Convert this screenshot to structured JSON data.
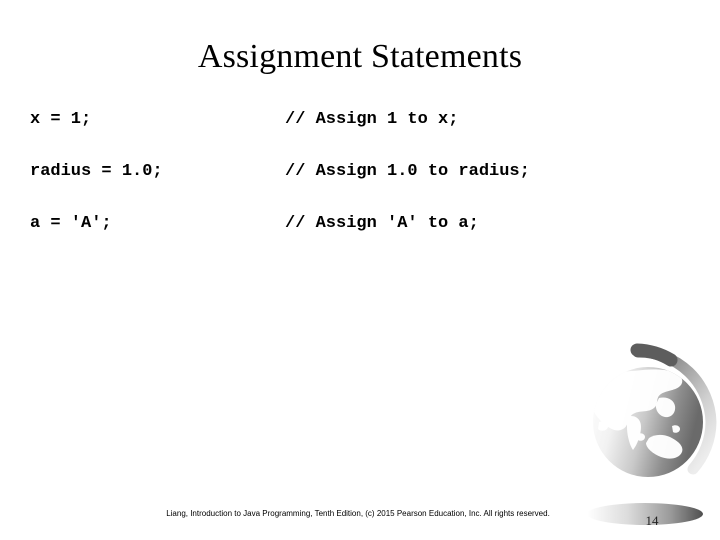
{
  "slide": {
    "title": "Assignment Statements",
    "background_color": "#ffffff",
    "text_color": "#000000"
  },
  "code": {
    "lines": [
      {
        "statement": "x = 1;",
        "comment": "// Assign 1 to x;"
      },
      {
        "statement": "radius = 1.0;",
        "comment": "// Assign 1.0 to radius;"
      },
      {
        "statement": "a = 'A';",
        "comment": "// Assign 'A' to a;"
      }
    ]
  },
  "decoration": {
    "globe_icon": "globe-icon",
    "globe_colors": {
      "light": "#fdfdfd",
      "mid": "#b8b8b8",
      "dark": "#6e6e6e",
      "ring_dark": "#595959",
      "shadow": "#555555"
    }
  },
  "footer": {
    "credit": "Liang, Introduction to Java Programming, Tenth Edition, (c) 2015 Pearson Education, Inc. All rights reserved.",
    "page_number": "14"
  }
}
